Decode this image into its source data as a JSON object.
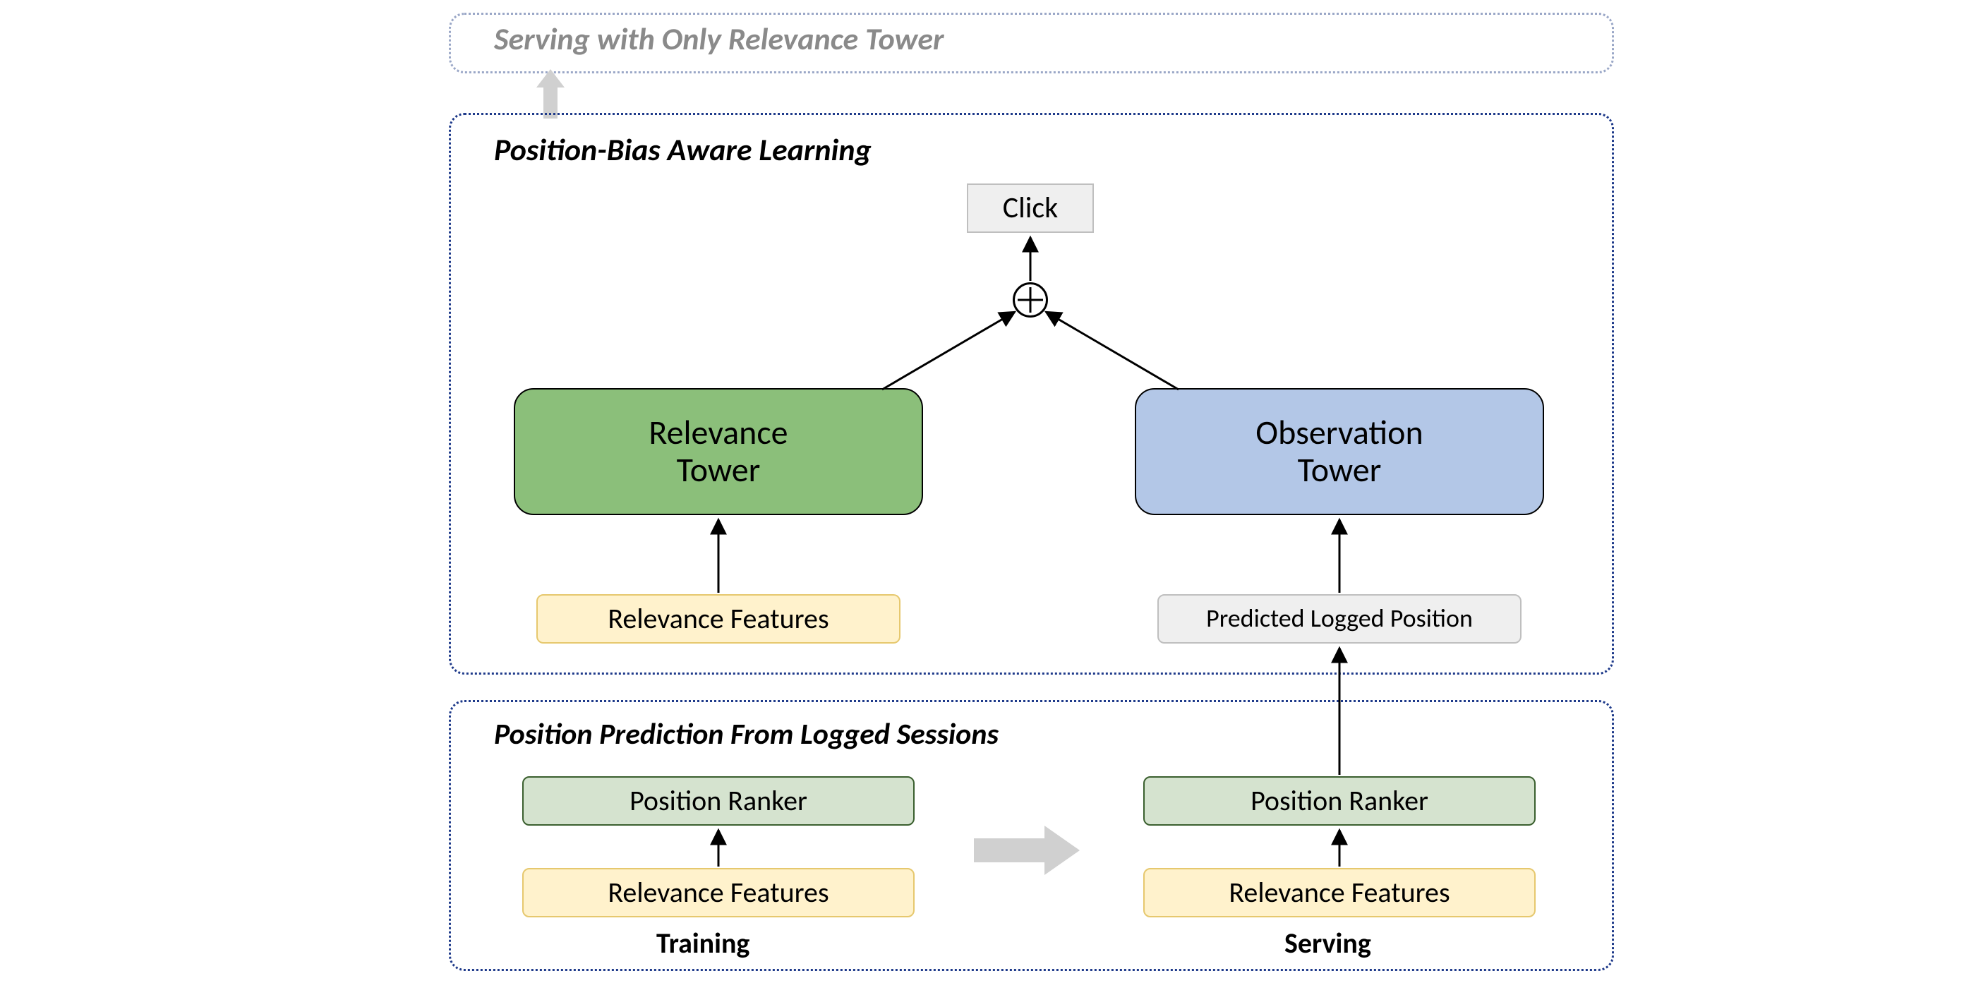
{
  "serving_box": {
    "title": "Serving with Only Relevance Tower"
  },
  "learning_box": {
    "title": "Position-Bias Aware Learning",
    "click": "Click",
    "relevance_tower": "Relevance\nTower",
    "observation_tower": "Observation\nTower",
    "relevance_features": "Relevance Features",
    "predicted_logged_position": "Predicted Logged Position"
  },
  "prediction_box": {
    "title": "Position Prediction From Logged Sessions",
    "training": {
      "position_ranker": "Position Ranker",
      "relevance_features": "Relevance Features",
      "label": "Training"
    },
    "serving": {
      "position_ranker": "Position Ranker",
      "relevance_features": "Relevance Features",
      "label": "Serving"
    }
  }
}
